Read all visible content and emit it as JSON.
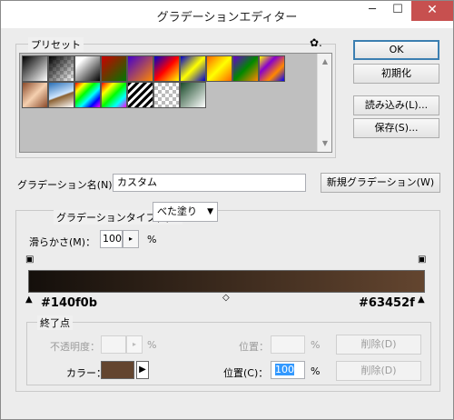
{
  "window": {
    "title": "グラデーションエディター",
    "minimize_glyph": "─",
    "maximize_glyph": "☐",
    "close_glyph": "✕"
  },
  "presets": {
    "label": "プリセット",
    "menu_icon": "gear-icon",
    "menu_glyph": "✿.",
    "scroll_up": "▲",
    "scroll_down": "▼"
  },
  "buttons": {
    "ok": "OK",
    "reset": "初期化",
    "load": "読み込み(L)...",
    "save": "保存(S)...",
    "new_gradient": "新規グラデーション(W)"
  },
  "name_field": {
    "label": "グラデーション名(N)：",
    "value": "カスタム"
  },
  "gradient": {
    "type_label": "グラデーションタイプ(T)：",
    "type_value": "べた塗り",
    "smoothness_label": "滑らかさ(M)：",
    "smoothness_value": "100",
    "smoothness_unit": "%",
    "start_color": "#140f0b",
    "end_color": "#63452f",
    "start_hex_label": "#140f0b",
    "end_hex_label": "#63452f"
  },
  "stops": {
    "group_label": "終了点",
    "opacity_label": "不透明度：",
    "opacity_value": "",
    "opacity_unit": "%",
    "opacity_position_label": "位置：",
    "opacity_position_value": "",
    "opacity_position_unit": "%",
    "opacity_delete": "削除(D)",
    "color_label": "カラー：",
    "color_value": "#63452f",
    "color_position_label": "位置(C)：",
    "color_position_value": "100",
    "color_position_unit": "%",
    "color_delete": "削除(D)"
  }
}
